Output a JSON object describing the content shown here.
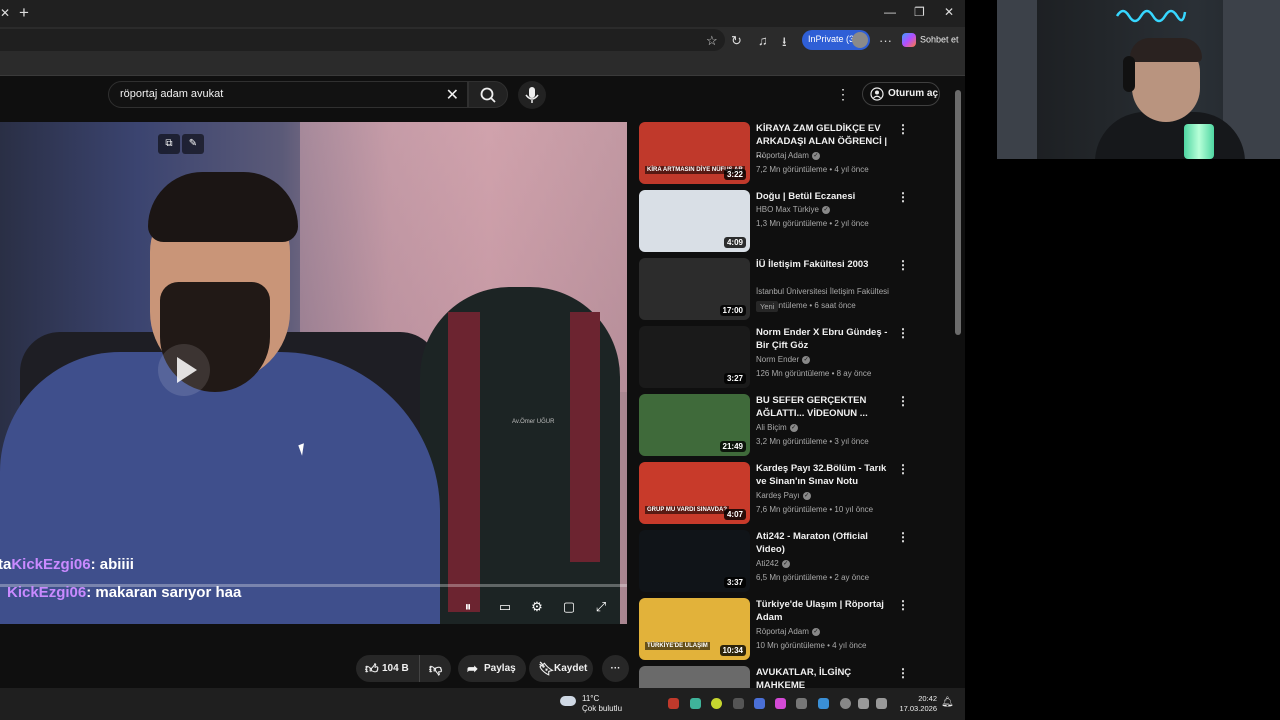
{
  "browser": {
    "inprivate_label": "InPrivate (3)",
    "copilot_label": "Sohbet et"
  },
  "youtube": {
    "search": {
      "query": "röportaj adam avukat"
    },
    "signin_label": "Oturum aç",
    "actions": {
      "like_count": "104 B",
      "share_label": "Paylaş",
      "save_label": "Kaydet"
    },
    "player": {
      "robe_name": "Av.Ömer UĞUR"
    },
    "recommendations": [
      {
        "title": "KİRAYA ZAM GELDİKÇE EV ARKADAŞI ALAN ÖĞRENCİ | ...",
        "channel": "Röportaj Adam",
        "verified": true,
        "meta": "7,2 Mn görüntüleme • 4 yıl önce",
        "duration": "3:22",
        "thumb_color": "#c0392b",
        "thumb_text": "KİRA ARTMASIN DİYE NÜFUS AR"
      },
      {
        "title": "Doğu | Betül Eczanesi",
        "channel": "HBO Max Türkiye",
        "verified": true,
        "meta": "1,3 Mn görüntüleme • 2 yıl önce",
        "duration": "4:09",
        "thumb_color": "#d9dfe6",
        "thumb_text": ""
      },
      {
        "title": "İÜ İletişim Fakültesi 2003",
        "channel": "İstanbul Üniversitesi İletişim Fakültesi",
        "verified": false,
        "meta": "6 görüntüleme • 6 saat önce",
        "badge": "Yeni",
        "duration": "17:00",
        "thumb_color": "#2c2c2c",
        "thumb_text": ""
      },
      {
        "title": "Norm Ender X Ebru Gündeş - Bir Çift Göz",
        "channel": "Norm Ender",
        "verified": true,
        "meta": "126 Mn görüntüleme • 8 ay önce",
        "duration": "3:27",
        "thumb_color": "#1a1a1a",
        "thumb_text": ""
      },
      {
        "title": "BU SEFER GERÇEKTEN AĞLATTI... VİDEONUN ...",
        "channel": "Ali Biçim",
        "verified": true,
        "meta": "3,2 Mn görüntüleme • 3 yıl önce",
        "duration": "21:49",
        "thumb_color": "#3f6a3a",
        "thumb_text": ""
      },
      {
        "title": "Kardeş Payı 32.Bölüm - Tarık ve Sinan'ın Sınav Notu",
        "channel": "Kardeş Payı",
        "verified": true,
        "meta": "7,6 Mn görüntüleme • 10 yıl önce",
        "duration": "4:07",
        "thumb_color": "#c83a2a",
        "thumb_text": "GRUP MU VARDI SINAVDA?"
      },
      {
        "title": "Ati242 - Maraton (Official Video)",
        "channel": "Ati242",
        "verified": true,
        "meta": "6,5 Mn görüntüleme • 2 ay önce",
        "duration": "3:37",
        "thumb_color": "#101418",
        "thumb_text": ""
      },
      {
        "title": "Türkiye'de Ulaşım | Röportaj Adam",
        "channel": "Röportaj Adam",
        "verified": true,
        "meta": "10 Mn görüntüleme • 4 yıl önce",
        "duration": "10:34",
        "thumb_color": "#e2b23a",
        "thumb_text": "TÜRKİYE'DE ULAŞIM"
      },
      {
        "title": "AVUKATLAR, İLGİNÇ MAHKEME",
        "channel": "",
        "verified": false,
        "meta": "",
        "duration": "",
        "thumb_color": "#6a6a6a",
        "thumb_text": ""
      }
    ]
  },
  "chat": [
    {
      "user": "KickEzgi06",
      "message": ": abiiii",
      "prefix": "ta"
    },
    {
      "user": "KickEzgi06",
      "message": ": makaran sarıyor haa",
      "prefix": ""
    }
  ],
  "taskbar": {
    "weather_temp": "11°C",
    "weather_desc": "Çok bulutlu",
    "time": "20:42",
    "date": "17.03.2026"
  },
  "colors": {
    "accent": "#2f5fd6",
    "chat_user": "#c98aff",
    "neon": "#37d7ff"
  }
}
